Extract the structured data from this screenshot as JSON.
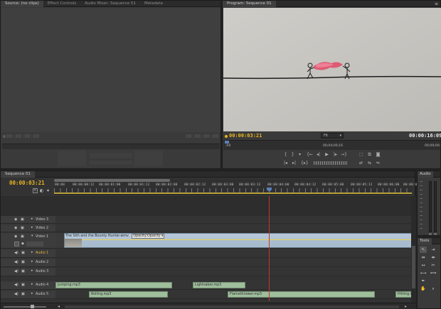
{
  "source_panel": {
    "tabs": [
      "Source: (no clips)",
      "Effect Controls",
      "Audio Mixer: Sequence 01",
      "Metadata"
    ],
    "timecode_left": "00:00:00:00",
    "timecode_right": "00:00:00:00"
  },
  "program_panel": {
    "tab": "Program: Sequence 01",
    "timecode_current": "00:00:03:21",
    "timecode_duration": "00:00:16:09",
    "fit_label": "Fit",
    "ruler_start": ";00",
    "ruler_mid": "00;04;00;16",
    "ruler_end": "00;09;00;",
    "preview_colors": {
      "paper": "#c9c7c2",
      "flame": "#e0506a"
    }
  },
  "timeline": {
    "tab": "Sequence 01",
    "timecode": "00:00:03:21",
    "ruler_labels": [
      "00:00",
      "00:00:00:12",
      "00:00:01:00",
      "00:00:01:12",
      "00:00:02:00",
      "00:00:02:12",
      "00:00:03:00",
      "00:00:03:12",
      "00:00:04:00",
      "00:00:04:12",
      "00:00:05:00",
      "00:00:05:12",
      "00:00:06:00",
      "00:00:06:"
    ],
    "playhead_color": "#c0392b",
    "tracks": {
      "video3": "Video 3",
      "video2": "Video 2",
      "video1": "Video 1",
      "audio1": "Audio 1",
      "audio2": "Audio 2",
      "audio3": "Audio 3",
      "audio4": "Audio 4",
      "audio5": "Audio 5"
    },
    "video_clip": {
      "name": "The Sith and the Bounty Hunter.wmv",
      "effect": "Opacity:Opacity"
    },
    "audio4_clips": [
      "Jumping.mp3",
      "Lightsaber.mp3"
    ],
    "audio5_clips": [
      "Rolling.mp3",
      "Flamethrower.mp3",
      "Hitting.m"
    ]
  },
  "audio_meter_panel": {
    "tab": "Audio"
  },
  "tools_panel": {
    "tab": "Tools"
  }
}
